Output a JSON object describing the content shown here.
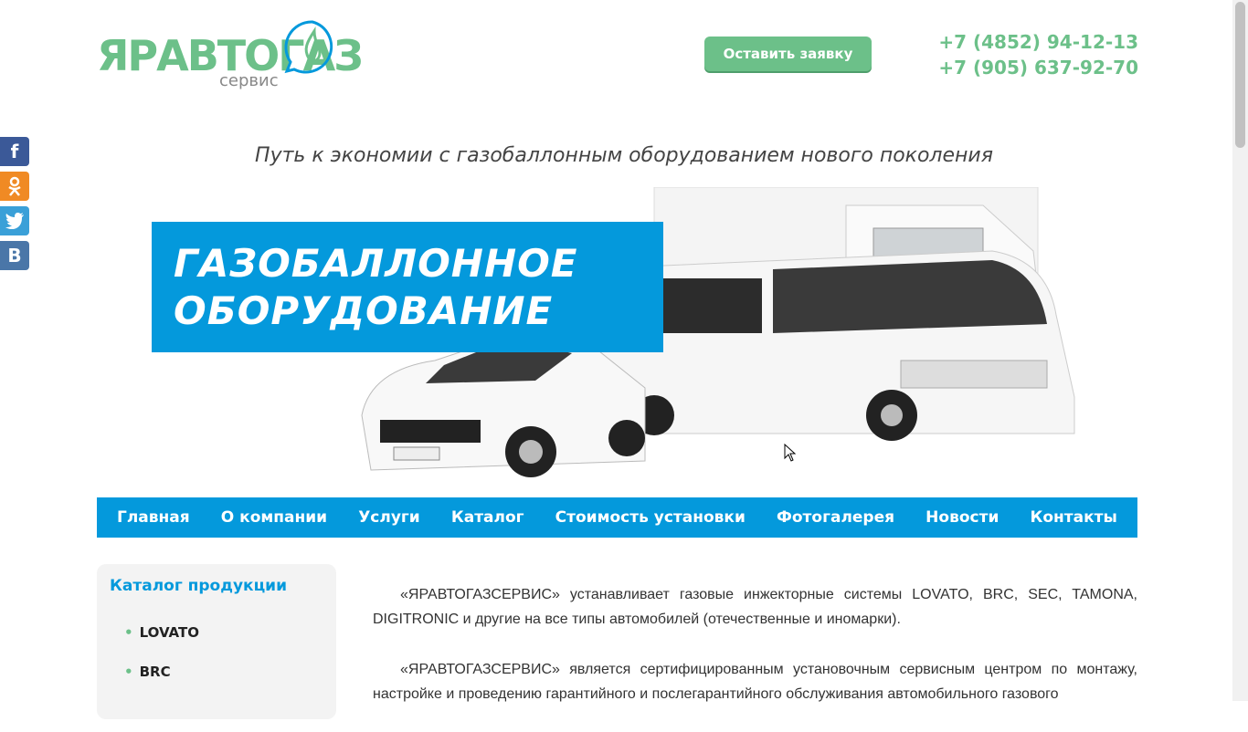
{
  "header": {
    "logo_main": "ЯРАВТОГАЗ",
    "logo_sub": "сервис",
    "cta_label": "Оставить заявку",
    "phones": [
      "+7 (4852) 94-12-13",
      "+7 (905) 637-92-70"
    ]
  },
  "tagline": "Путь к экономии с газобаллонным оборудованием нового поколения",
  "banner": {
    "title_line1": "ГАЗОБАЛЛОННОЕ",
    "title_line2": "ОБОРУДОВАНИЕ"
  },
  "social": [
    {
      "icon": "facebook-icon",
      "glyph": "f"
    },
    {
      "icon": "odnoklassniki-icon",
      "glyph": "ok"
    },
    {
      "icon": "twitter-icon",
      "glyph": "t"
    },
    {
      "icon": "vkontakte-icon",
      "glyph": "B"
    }
  ],
  "nav": [
    "Главная",
    "О компании",
    "Услуги",
    "Каталог",
    "Стоимость установки",
    "Фотогалерея",
    "Новости",
    "Контакты"
  ],
  "catalog": {
    "title": "Каталог продукции",
    "items": [
      "LOVATO",
      "BRC"
    ]
  },
  "content": {
    "p1": "«ЯРАВТОГАЗСЕРВИС» устанавливает газовые инжекторные системы LOVATO, BRC, SEC, TAMONA, DIGITRONIC и другие на все типы автомобилей (отечественные и иномарки).",
    "p2": "«ЯРАВТОГАЗСЕРВИС» является сертифицированным установочным сервисным центром по монтажу, настройке и проведению гарантийного и послегарантийного обслуживания автомобильного газового"
  },
  "colors": {
    "accent_blue": "#0499dc",
    "accent_green": "#6cc089"
  }
}
